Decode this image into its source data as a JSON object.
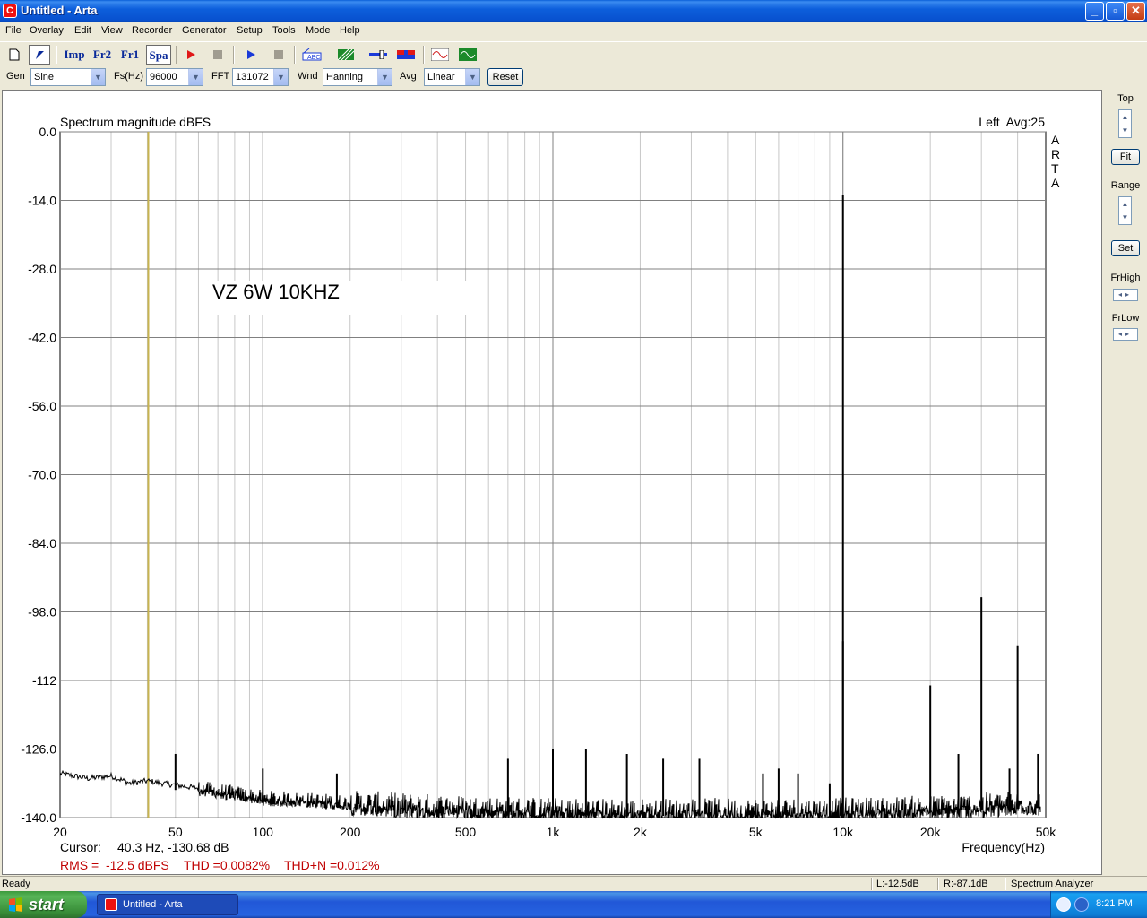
{
  "window": {
    "title": "Untitled - Arta",
    "icon_letter": "C",
    "minimize": "_",
    "maximize": "▫",
    "close": "✕"
  },
  "menu": [
    "File",
    "Overlay",
    "Edit",
    "View",
    "Recorder",
    "Generator",
    "Setup",
    "Tools",
    "Mode",
    "Help"
  ],
  "toolbar": {
    "imp": "Imp",
    "fr2": "Fr2",
    "fr1": "Fr1",
    "spa": "Spa",
    "icons": [
      "new-icon",
      "cursor-icon",
      "record-icon",
      "stop-icon",
      "play-icon",
      "stop2-icon",
      "abc-icon",
      "hatch-icon",
      "slider-icon",
      "meter-icon",
      "sine-icon",
      "scope-icon"
    ]
  },
  "controls": {
    "gen_label": "Gen",
    "gen_value": "Sine",
    "fs_label": "Fs(Hz)",
    "fs_value": "96000",
    "fft_label": "FFT",
    "fft_value": "131072",
    "wnd_label": "Wnd",
    "wnd_value": "Hanning",
    "avg_label": "Avg",
    "avg_value": "Linear",
    "reset": "Reset"
  },
  "right_panel": {
    "top": "Top",
    "fit": "Fit",
    "range": "Range",
    "set": "Set",
    "frhigh": "FrHigh",
    "frlow": "FrLow"
  },
  "plot": {
    "title": "Spectrum magnitude dBFS",
    "channel": "Left  Avg:25",
    "watermark": "ARTA",
    "annotation": "VZ 6W 10KHZ",
    "cursor_label": "Cursor:",
    "cursor_value": "40.3 Hz, -130.68 dB",
    "xlabel": "Frequency(Hz)",
    "rms": "RMS =  -12.5 dBFS",
    "thd": "THD =0.0082%",
    "thdn": "THD+N =0.012%",
    "cursor_color": "#c8b450",
    "measure_color": "#c00000"
  },
  "chart_data": {
    "type": "line",
    "x_scale": "log",
    "xlim": [
      20,
      50000
    ],
    "ylim": [
      -140,
      0
    ],
    "grid": true,
    "y_ticks": [
      "0.0",
      "-14.0",
      "-28.0",
      "-42.0",
      "-56.0",
      "-70.0",
      "-84.0",
      "-98.0",
      "-112",
      "-126.0",
      "-140.0"
    ],
    "x_ticks": [
      {
        "f": 20,
        "label": "20"
      },
      {
        "f": 50,
        "label": "50"
      },
      {
        "f": 100,
        "label": "100"
      },
      {
        "f": 200,
        "label": "200"
      },
      {
        "f": 500,
        "label": "500"
      },
      {
        "f": 1000,
        "label": "1k"
      },
      {
        "f": 2000,
        "label": "2k"
      },
      {
        "f": 5000,
        "label": "5k"
      },
      {
        "f": 10000,
        "label": "10k"
      },
      {
        "f": 20000,
        "label": "20k"
      },
      {
        "f": 50000,
        "label": "50k"
      }
    ],
    "cursor_freq": 40.3,
    "noise_floor_profile": [
      [
        20,
        -131
      ],
      [
        25,
        -132
      ],
      [
        30,
        -131.5
      ],
      [
        35,
        -133
      ],
      [
        40,
        -132.5
      ],
      [
        45,
        -133
      ],
      [
        60,
        -134
      ],
      [
        80,
        -135
      ],
      [
        100,
        -136
      ],
      [
        150,
        -136.5
      ],
      [
        200,
        -137
      ],
      [
        500,
        -138
      ],
      [
        1000,
        -138.5
      ],
      [
        2000,
        -138.7
      ],
      [
        5000,
        -138.5
      ],
      [
        10000,
        -138.5
      ],
      [
        20000,
        -138
      ],
      [
        30000,
        -137.5
      ],
      [
        48000,
        -137
      ]
    ],
    "peaks": [
      {
        "f": 10000,
        "db": -13
      },
      {
        "f": 10000.5,
        "db": -104
      },
      {
        "f": 20000,
        "db": -113
      },
      {
        "f": 30000,
        "db": -95
      },
      {
        "f": 40000,
        "db": -105
      },
      {
        "f": 25000,
        "db": -127
      },
      {
        "f": 37500,
        "db": -130
      },
      {
        "f": 47000,
        "db": -127
      },
      {
        "f": 50,
        "db": -127
      },
      {
        "f": 100,
        "db": -130
      },
      {
        "f": 180,
        "db": -131
      },
      {
        "f": 700,
        "db": -128
      },
      {
        "f": 1000,
        "db": -126
      },
      {
        "f": 1300,
        "db": -126
      },
      {
        "f": 1800,
        "db": -127
      },
      {
        "f": 2400,
        "db": -128
      },
      {
        "f": 3200,
        "db": -128
      },
      {
        "f": 5300,
        "db": -131
      },
      {
        "f": 6000,
        "db": -130
      },
      {
        "f": 7000,
        "db": -131
      },
      {
        "f": 9000,
        "db": -133
      }
    ]
  },
  "status": {
    "ready": "Ready",
    "left_level": "L:-12.5dB",
    "right_level": "R:-87.1dB",
    "mode": "Spectrum Analyzer"
  },
  "taskbar": {
    "start": "start",
    "task": "Untitled - Arta",
    "time": "8:21 PM"
  }
}
